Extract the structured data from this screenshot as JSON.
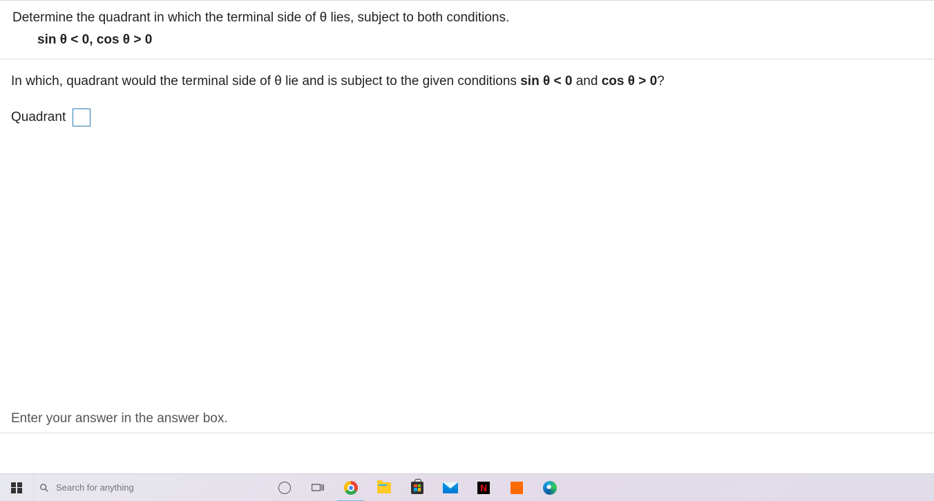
{
  "problem": {
    "statement": "Determine the quadrant in which the terminal side of θ lies, subject to both conditions.",
    "conditions": "sin θ  <  0,  cos θ  >  0"
  },
  "question": {
    "prefix": "In which, quadrant would the terminal side of θ lie and is subject to the given conditions ",
    "cond1": "sin θ  <  0",
    "mid": " and ",
    "cond2": "cos θ  >  0",
    "suffix": "?"
  },
  "answer": {
    "label": "Quadrant",
    "value": ""
  },
  "instruction": "Enter your answer in the answer box.",
  "taskbar": {
    "search_placeholder": "Search for anything",
    "netflix_letter": "N"
  }
}
